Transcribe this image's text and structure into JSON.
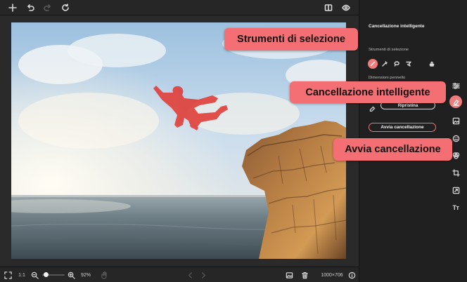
{
  "toolbar": {
    "icons": [
      "plus-icon",
      "undo-icon",
      "redo-icon",
      "refresh-icon",
      "compare-icon",
      "eye-icon",
      "save-icon"
    ]
  },
  "panel": {
    "title": "Cancellazione intelligente",
    "selection_tools_label": "Strumenti di selezione",
    "brush_size_label": "Dimensioni pennello",
    "reset_label": "Ripristina",
    "start_label": "Avvia cancellazione"
  },
  "bottom": {
    "ratio_label": "1:1",
    "zoom_value": "92%",
    "image_size": "1000×706"
  },
  "rail": {
    "text_tool_label": "Tт"
  },
  "callouts": {
    "selection_tools": "Strumenti di selezione",
    "smart_erase": "Cancellazione intelligente",
    "start_erase": "Avvia cancellazione"
  },
  "colors": {
    "accent": "#f46f74",
    "background": "#1e1e1e",
    "panel": "#202020"
  }
}
